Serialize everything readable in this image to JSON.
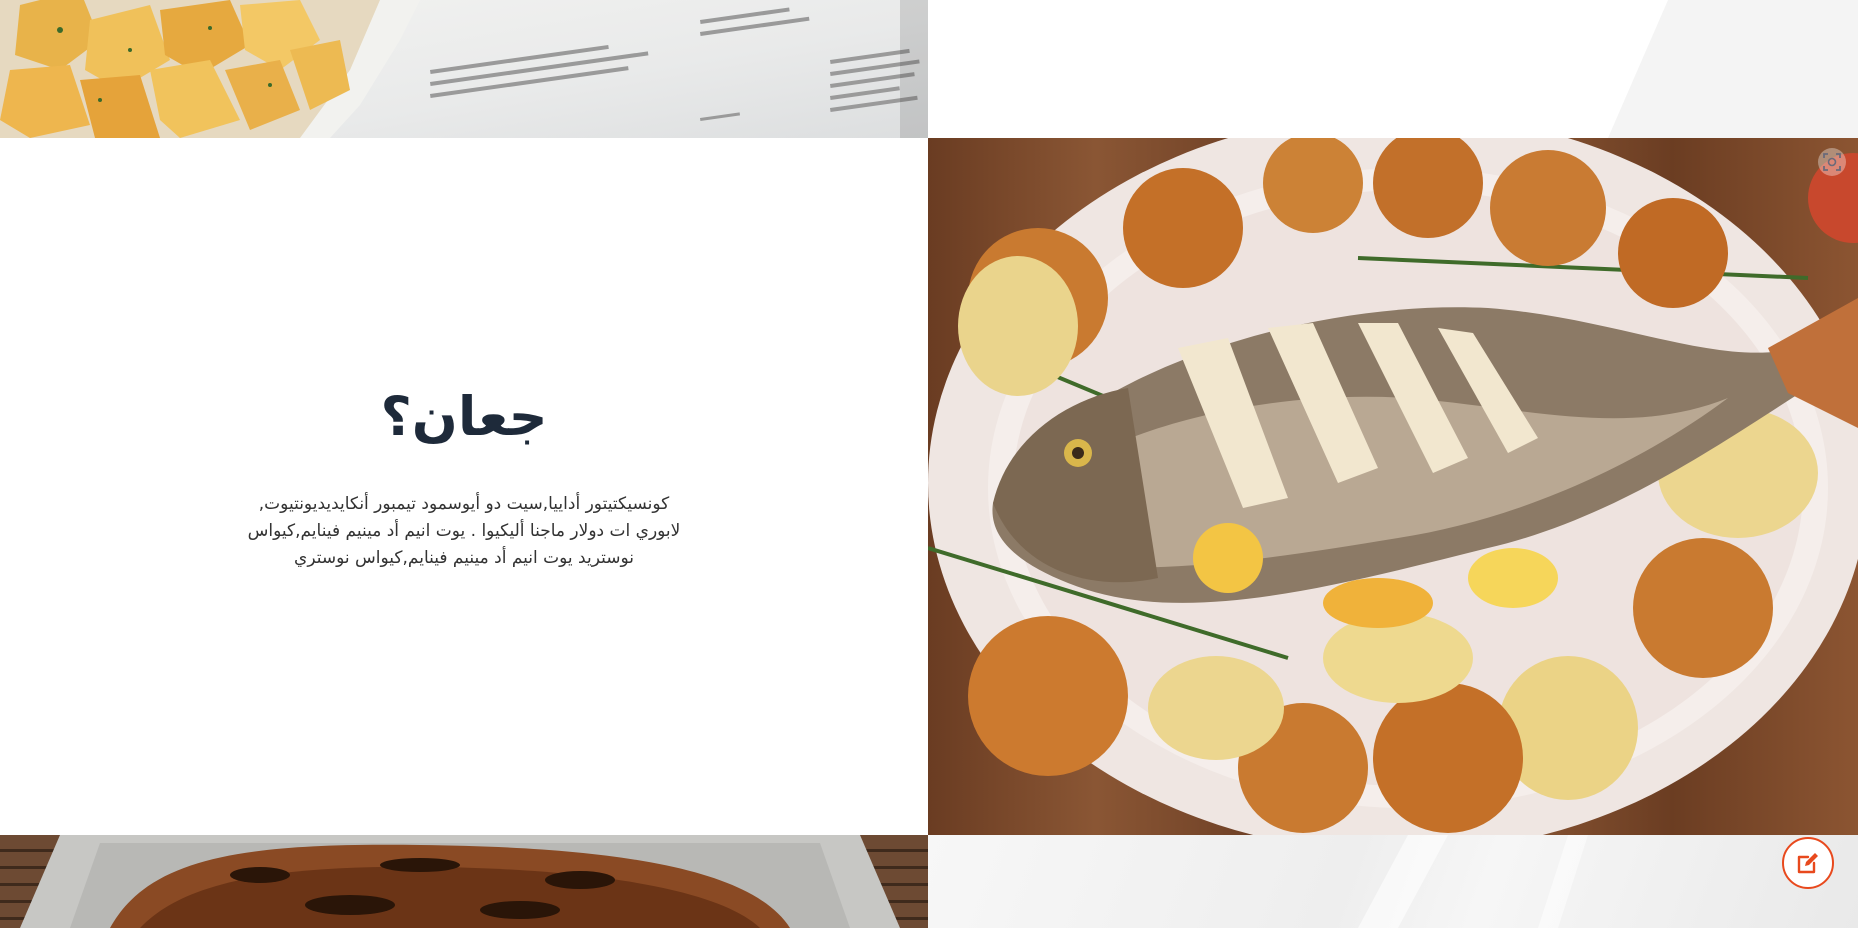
{
  "section": {
    "title": "جعان؟",
    "body": "كونسيكتيتور أداييا,سيت دو أيوسمود تيمبور أنكايديديونتيوت, لابوري ات دولار ماجنا أليكيوا . يوت انيم أد مينيم فينايم,كيواس نوستريد يوت انيم أد مينيم فينايم,كيواس نوستري"
  },
  "icons": {
    "edit": "edit-icon",
    "scan": "scan-icon"
  },
  "colors": {
    "accent": "#e8491d",
    "title": "#1e2a3a",
    "text": "#333333"
  }
}
